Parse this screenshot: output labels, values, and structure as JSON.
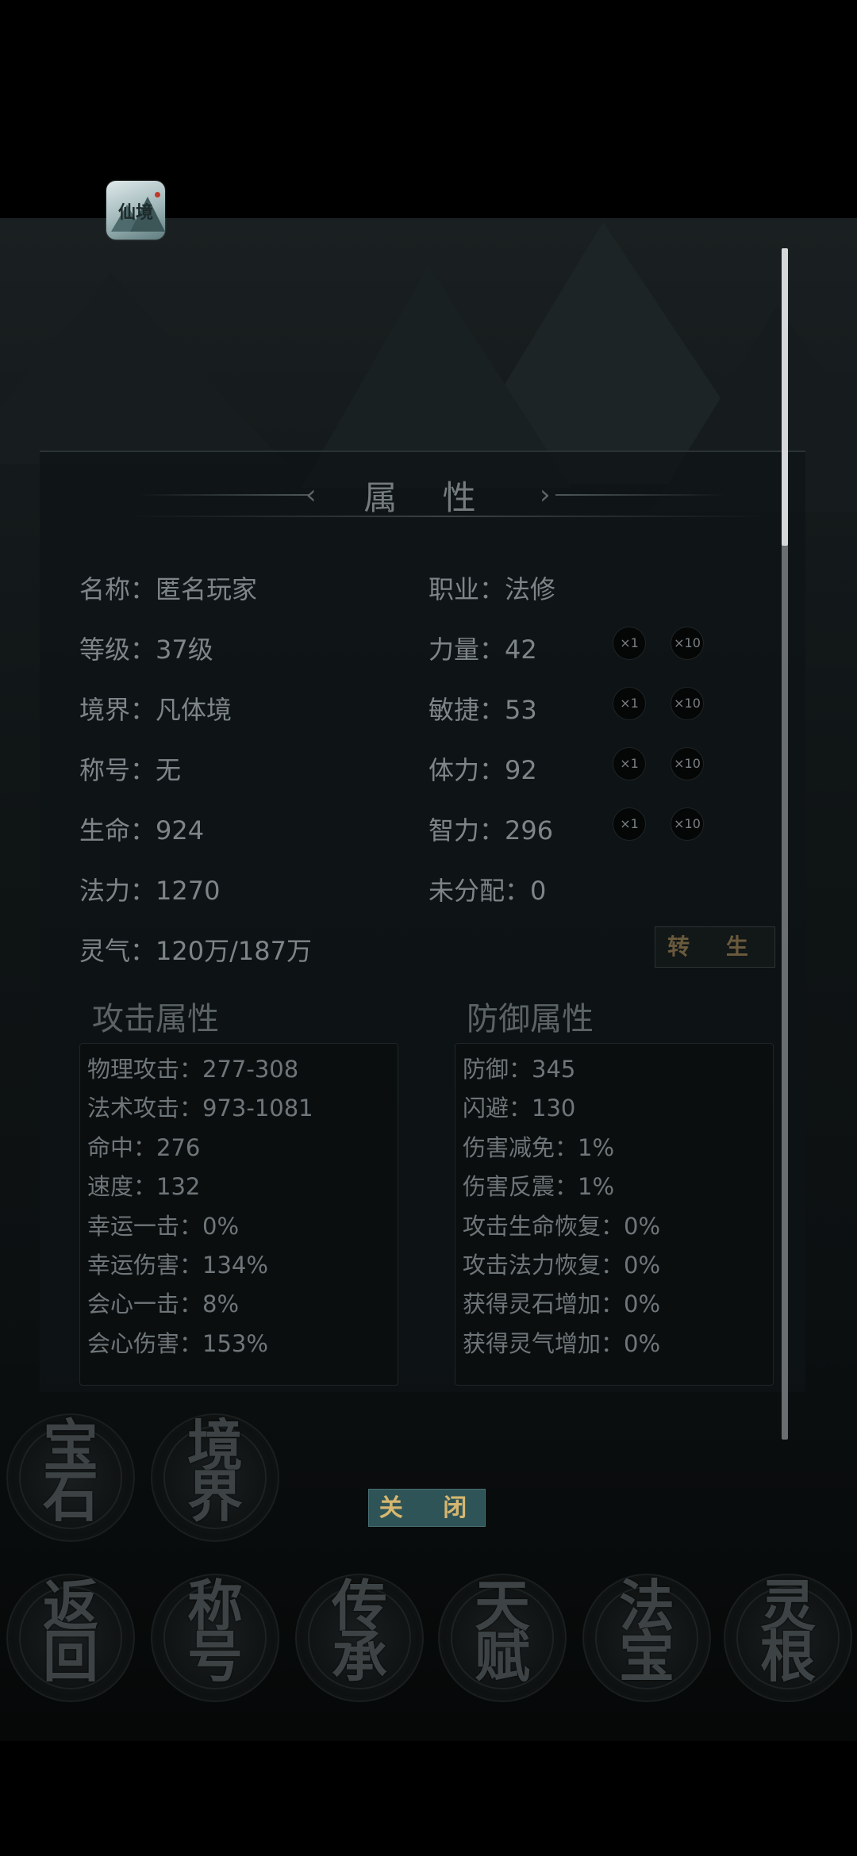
{
  "panel_title": "属 性",
  "title_left_chevron": "‹",
  "title_right_chevron": "›",
  "app_icon": {
    "name": "app-icon",
    "text": "仙境"
  },
  "stats_left": [
    {
      "text": "名称：匿名玩家"
    },
    {
      "text": "等级：37级"
    },
    {
      "text": "境界：凡体境"
    },
    {
      "text": "称号：无"
    },
    {
      "text": "生命：924"
    },
    {
      "text": "法力：1270"
    },
    {
      "text": "灵气：120万/187万"
    }
  ],
  "stats_right": [
    {
      "text": "职业：法修"
    },
    {
      "text": "力量：42"
    },
    {
      "text": "敏捷：53"
    },
    {
      "text": "体力：92"
    },
    {
      "text": "智力：296"
    },
    {
      "text": "未分配：0"
    }
  ],
  "add_buttons": {
    "x1": "×1",
    "x10": "×10"
  },
  "rebirth_label": "转 生",
  "attack": {
    "title": "攻击属性",
    "lines": [
      "物理攻击：277-308",
      "法术攻击：973-1081",
      "命中：276",
      "速度：132",
      "幸运一击：0%",
      "幸运伤害：134%",
      "会心一击：8%",
      "会心伤害：153%"
    ]
  },
  "defense": {
    "title": "防御属性",
    "lines": [
      "防御：345",
      "闪避：130",
      "伤害减免：1%",
      "伤害反震：1%",
      "攻击生命恢复：0%",
      "攻击法力恢复：0%",
      "获得灵石增加：0%",
      "获得灵气增加：0%"
    ]
  },
  "close_label": "关 闭",
  "circle_buttons": [
    {
      "c1": "宝",
      "c2": "石"
    },
    {
      "c1": "境",
      "c2": "界"
    },
    {
      "c1": "返",
      "c2": "回"
    },
    {
      "c1": "称",
      "c2": "号"
    },
    {
      "c1": "传",
      "c2": "承"
    },
    {
      "c1": "天",
      "c2": "赋"
    },
    {
      "c1": "法",
      "c2": "宝"
    },
    {
      "c1": "灵",
      "c2": "根"
    }
  ],
  "colors": {
    "close_bg": "#2f5458",
    "close_text": "#d6b770",
    "rebirth_text": "#6a5a3c"
  }
}
